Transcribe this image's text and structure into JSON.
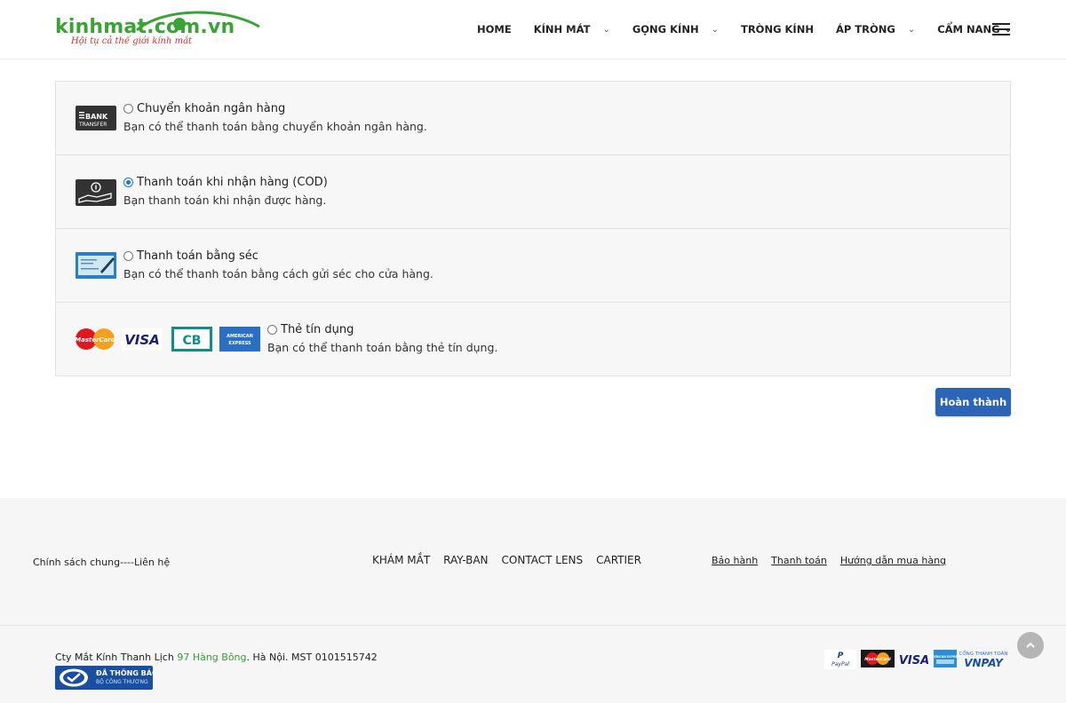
{
  "header": {
    "logo_text": "kinhmat.com.vn",
    "logo_slogan": "Hội tụ cả thế giới kính mắt",
    "nav": [
      {
        "label": "HOME",
        "has_dropdown": false
      },
      {
        "label": "KÍNH MÁT",
        "has_dropdown": true
      },
      {
        "label": "GỌNG KÍNH",
        "has_dropdown": true
      },
      {
        "label": "TRÒNG KÍNH",
        "has_dropdown": false
      },
      {
        "label": "ÁP TRÒNG",
        "has_dropdown": true
      },
      {
        "label": "CẨM NANG",
        "has_dropdown": true
      }
    ],
    "menu_icon": "hamburger-icon"
  },
  "payment": {
    "methods": [
      {
        "title": "Chuyển khoản ngân hàng",
        "description": "Bạn có thể thanh toán bằng chuyển khoản ngân hàng.",
        "selected": false,
        "icon": "bank-transfer-icon",
        "icon_text": [
          "BANK",
          "TRANSFER"
        ]
      },
      {
        "title": "Thanh toán khi nhận hàng (COD)",
        "description": "Bạn thanh toán khi nhận được hàng.",
        "selected": true,
        "icon": "cash-on-delivery-icon"
      },
      {
        "title": "Thanh toán bằng séc",
        "description": "Bạn có thể thanh toán bằng cách gửi séc cho cửa hàng.",
        "selected": false,
        "icon": "cheque-icon"
      },
      {
        "title": "Thẻ tín dụng",
        "description": "Bạn có thể thanh toán bằng thẻ tín dụng.",
        "selected": false,
        "icon": "credit-cards-icon",
        "card_logos": [
          "MasterCard",
          "VISA",
          "CB",
          "AMERICAN EXPRESS"
        ]
      }
    ],
    "submit_label": "Hoàn thành"
  },
  "footer": {
    "policy_text": "Chính sách chung----Liên hệ",
    "mid_links": [
      "KHÁM MẮT",
      "RAY-BAN",
      "CONTACT LENS",
      "CARTIER"
    ],
    "right_links": [
      "Bảo hành",
      "Thanh toán",
      "Hướng dẫn mua hàng"
    ],
    "company_prefix": "Cty Mắt Kính Thanh Lịch ",
    "company_address": "97 Hàng Bông",
    "company_suffix": ". Hà Nội. MST 0101515742",
    "badge_line1": "ĐÃ THÔNG BÁO",
    "badge_line2": "BỘ CÔNG THƯƠNG",
    "payment_logos": [
      "PayPal",
      "MasterCard",
      "VISA",
      "AMERICAN EXPRESS",
      "CỔNG THANH TOÁN",
      "VNPAY"
    ]
  },
  "colors": {
    "accent": "#2c65b8",
    "logo_green": "#3aa335",
    "logo_red": "#d9302c",
    "address_green": "#3a9a3a"
  }
}
